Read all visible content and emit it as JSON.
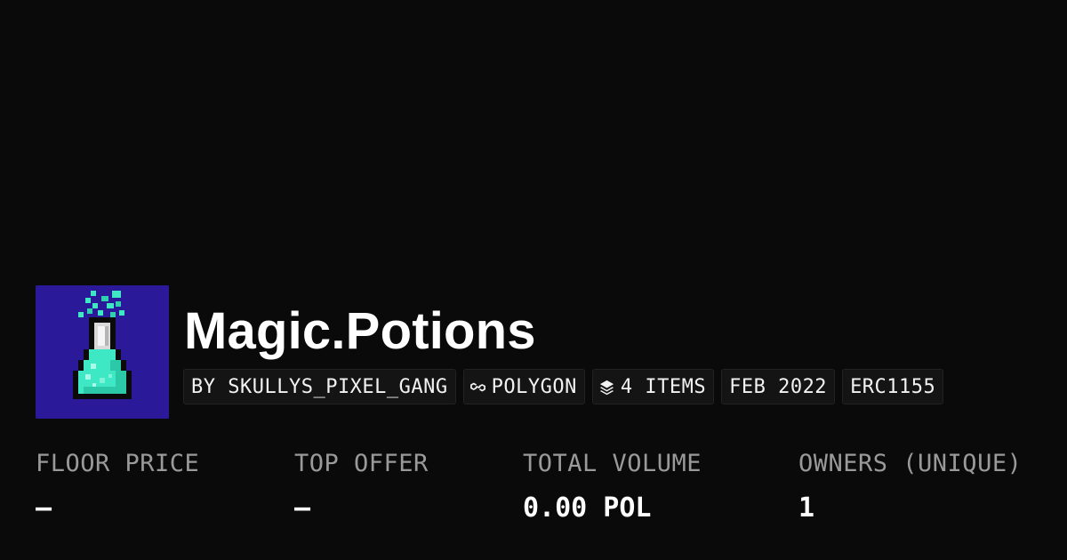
{
  "collection": {
    "name": "Magic.Potions",
    "avatar_icon": "potion-flask-icon",
    "avatar_bg": "#2a1a9a",
    "potion_color": "#3ee8c4"
  },
  "chips": {
    "creator": "BY SKULLYS_PIXEL_GANG",
    "chain_icon": "polygon-icon",
    "chain": "POLYGON",
    "items_icon": "layers-icon",
    "items": "4 ITEMS",
    "date": "FEB 2022",
    "standard": "ERC1155"
  },
  "stats": {
    "floor_price": {
      "label": "FLOOR PRICE",
      "value": "–"
    },
    "top_offer": {
      "label": "TOP OFFER",
      "value": "–"
    },
    "total_volume": {
      "label": "TOTAL VOLUME",
      "value": "0.00 POL"
    },
    "owners": {
      "label": "OWNERS (UNIQUE)",
      "value": "1"
    }
  },
  "colors": {
    "background": "#0a0a0a",
    "chip_bg": "#141414",
    "label": "#9a9a9a",
    "text": "#ffffff"
  }
}
